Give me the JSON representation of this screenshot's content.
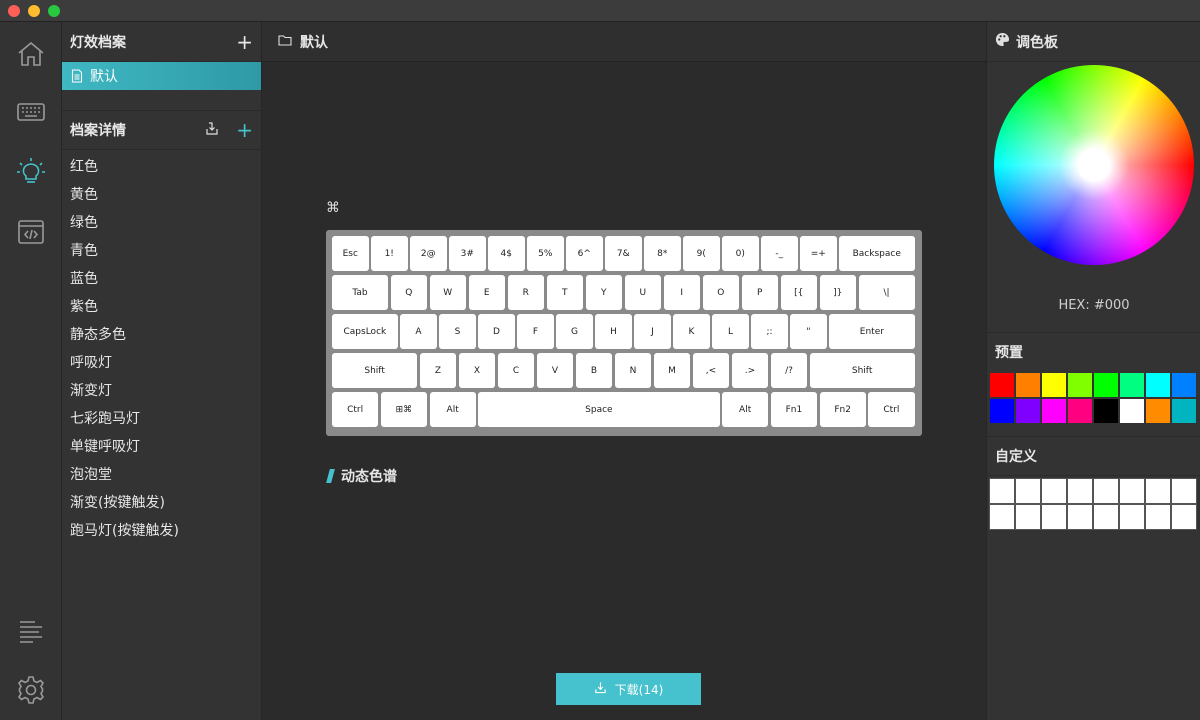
{
  "profiles": {
    "title": "灯效档案",
    "items": [
      {
        "label": "默认"
      }
    ]
  },
  "details": {
    "title": "档案详情",
    "items": [
      "红色",
      "黄色",
      "绿色",
      "青色",
      "蓝色",
      "紫色",
      "静态多色",
      "呼吸灯",
      "渐变灯",
      "七彩跑马灯",
      "单键呼吸灯",
      "泡泡堂",
      "渐变(按键触发)",
      "跑马灯(按键触发)"
    ]
  },
  "main": {
    "title": "默认",
    "cmd_symbol": "⌘",
    "dynamic_title": "动态色谱",
    "download_label": "下载(14)"
  },
  "keyboard": {
    "rows": [
      [
        "Esc",
        "1!",
        "2@",
        "3#",
        "4$",
        "5%",
        "6^",
        "7&",
        "8*",
        "9(",
        "0)",
        "-_",
        "=+",
        "Backspace"
      ],
      [
        "Tab",
        "Q",
        "W",
        "E",
        "R",
        "T",
        "Y",
        "U",
        "I",
        "O",
        "P",
        "[{",
        "]}",
        "\\|"
      ],
      [
        "CapsLock",
        "A",
        "S",
        "D",
        "F",
        "G",
        "H",
        "J",
        "K",
        "L",
        ";:",
        "\"",
        "Enter"
      ],
      [
        "Shift",
        "Z",
        "X",
        "C",
        "V",
        "B",
        "N",
        "M",
        ",<",
        ".>",
        "/?",
        "Shift"
      ],
      [
        "Ctrl",
        "⊞⌘",
        "Alt",
        "Space",
        "Alt",
        "Fn1",
        "Fn2",
        "Ctrl"
      ]
    ]
  },
  "palette": {
    "title": "调色板",
    "hex": "HEX: #000",
    "preset_title": "预置",
    "presets": [
      "#ff0000",
      "#ff8000",
      "#ffff00",
      "#80ff00",
      "#00ff00",
      "#00ff80",
      "#00ffff",
      "#0080ff",
      "#0000ff",
      "#8000ff",
      "#ff00ff",
      "#ff0080",
      "#000000",
      "#ffffff",
      "#ff8c00",
      "#00b5c0"
    ],
    "custom_title": "自定义",
    "custom_count": 16
  },
  "colors": {
    "accent": "#45c2ce",
    "background": "#2b2b2b",
    "panel": "#333333"
  },
  "icons": [
    "home-icon",
    "keyboard-icon",
    "lightbulb-icon",
    "code-icon",
    "list-icon",
    "gear-icon",
    "folder-icon",
    "document-icon",
    "import-icon",
    "palette-icon",
    "download-icon"
  ]
}
